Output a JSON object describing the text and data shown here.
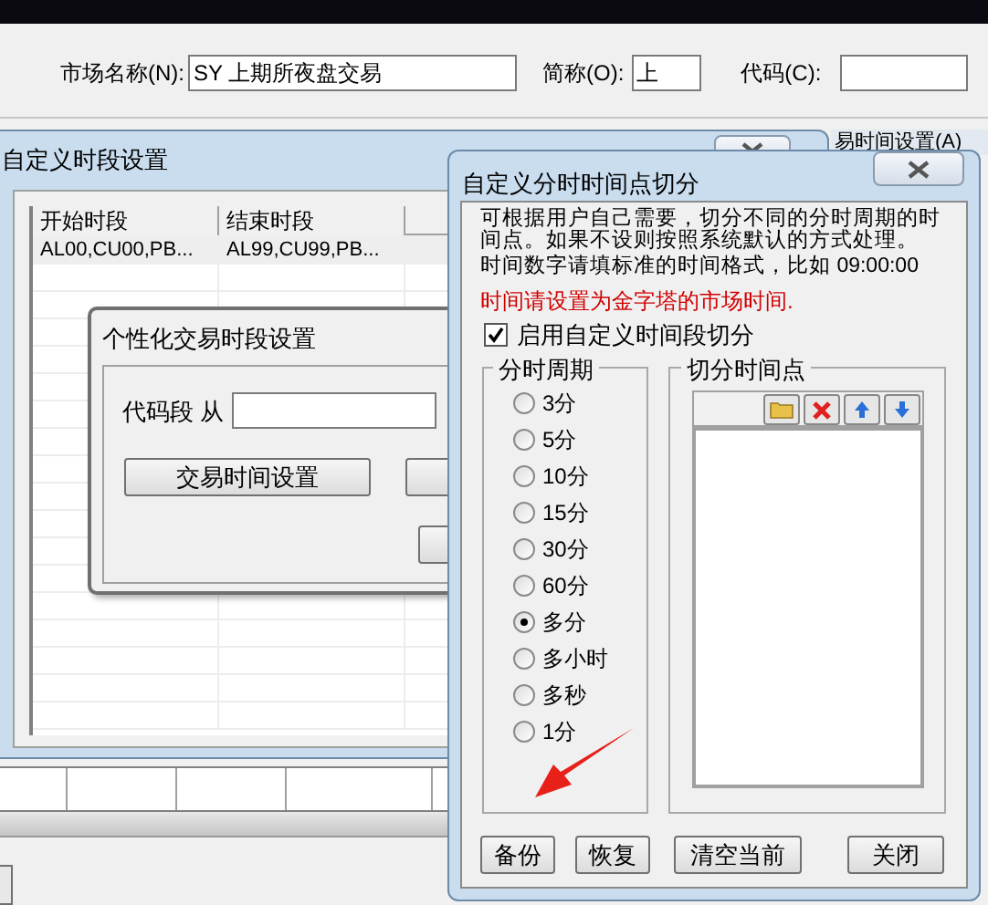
{
  "market_form": {
    "name_label": "市场名称(N):",
    "name_value": "SY 上期所夜盘交易",
    "short_label": "简称(O):",
    "short_value": "上",
    "code_label": "代码(C):"
  },
  "back_window": {
    "title": "自定义时段设置",
    "side_button": "易时间设置(A)",
    "table": {
      "columns": [
        "开始时段",
        "结束时段"
      ],
      "rows": [
        [
          "AL00,CU00,PB...",
          "AL99,CU99,PB..."
        ]
      ]
    }
  },
  "inner_dialog": {
    "title": "个性化交易时段设置",
    "range_label": "代码段 从",
    "settings_button": "交易时间设置"
  },
  "front_dialog": {
    "title": "自定义分时时间点切分",
    "description": "可根据用户自己需要，切分不同的分时周期的时间点。如果不设则按照系统默认的方式处理。",
    "format_hint": "时间数字请填标准的时间格式，比如 09:00:00",
    "warning": "时间请设置为金字塔的市场时间.",
    "enable": {
      "label": "启用自定义时间段切分",
      "checked": true
    },
    "period_group": {
      "title": "分时周期",
      "options": [
        {
          "label": "3分",
          "selected": false
        },
        {
          "label": "5分",
          "selected": false
        },
        {
          "label": "10分",
          "selected": false
        },
        {
          "label": "15分",
          "selected": false
        },
        {
          "label": "30分",
          "selected": false
        },
        {
          "label": "60分",
          "selected": false
        },
        {
          "label": "多分",
          "selected": true
        },
        {
          "label": "多小时",
          "selected": false
        },
        {
          "label": "多秒",
          "selected": false
        },
        {
          "label": "1分",
          "selected": false
        }
      ]
    },
    "points_group": {
      "title": "切分时间点"
    },
    "buttons": [
      "备份",
      "恢复",
      "清空当前",
      "关闭"
    ]
  }
}
